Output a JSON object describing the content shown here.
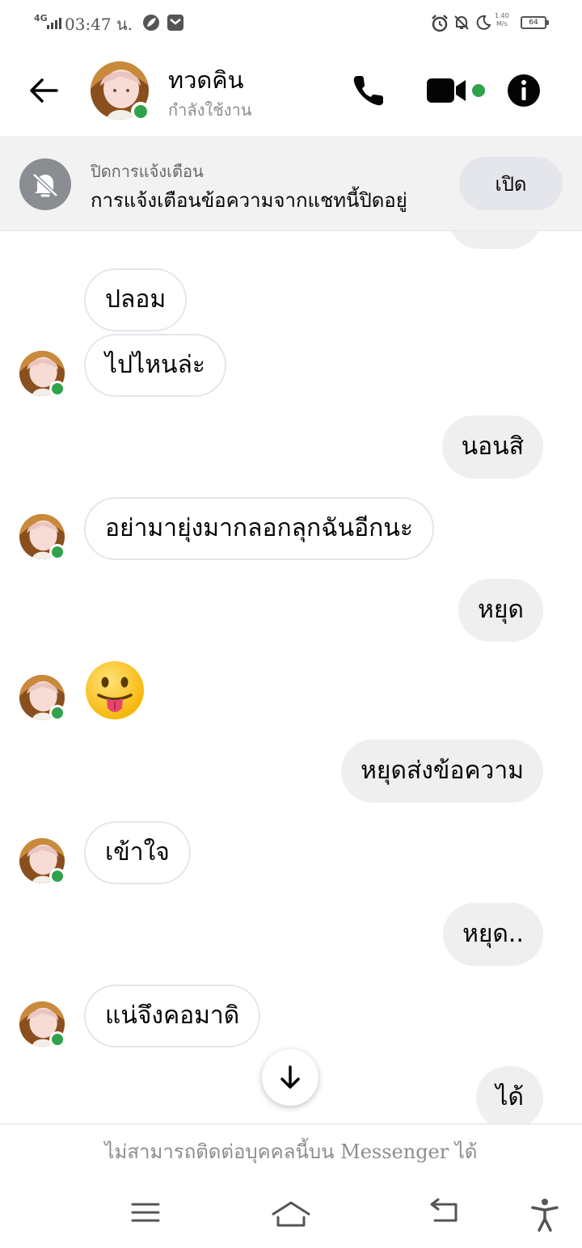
{
  "status_bar": {
    "network": "4G",
    "time": "03:47 น.",
    "speed": "1.40",
    "speed_unit": "M/s",
    "battery": "64"
  },
  "header": {
    "contact_name": "ทวดคิน",
    "contact_status": "กำลังใช้งาน",
    "icons": [
      "back-arrow-icon",
      "phone-icon",
      "video-camera-icon",
      "info-icon"
    ],
    "presence_color": "#31a24c"
  },
  "mute_banner": {
    "title": "ปิดการแจ้งเตือน",
    "description": "การแจ้งเตือนข้อความจากแชทนี้ปิดอยู่",
    "button_label": "เปิด",
    "icon": "bell-off-icon"
  },
  "messages": [
    {
      "direction": "in",
      "text": "ปลอม"
    },
    {
      "direction": "in",
      "text": "ไปไหนล่ะ"
    },
    {
      "direction": "out",
      "text": "นอนสิ"
    },
    {
      "direction": "in",
      "text": "อย่ามายุ่งมากลอกลุกฉันอีกนะ"
    },
    {
      "direction": "out",
      "text": "หยุด"
    },
    {
      "direction": "in",
      "emoji": "tongue-out-emoji"
    },
    {
      "direction": "out",
      "text": "หยุดส่งข้อความ"
    },
    {
      "direction": "in",
      "text": "เข้าใจ"
    },
    {
      "direction": "out",
      "text": "หยุด.."
    },
    {
      "direction": "in",
      "text": "แน่จึงคอมาดิ"
    },
    {
      "direction": "out",
      "text": "ได้"
    }
  ],
  "footer": {
    "notice": "ไม่สามารถติดต่อบุคคลนี้บน Messenger ได้"
  },
  "colors": {
    "incoming_bubble": "#ffffff",
    "outgoing_bubble": "#efefef",
    "banner_bg": "#f2f2f2",
    "presence": "#31a24c"
  }
}
